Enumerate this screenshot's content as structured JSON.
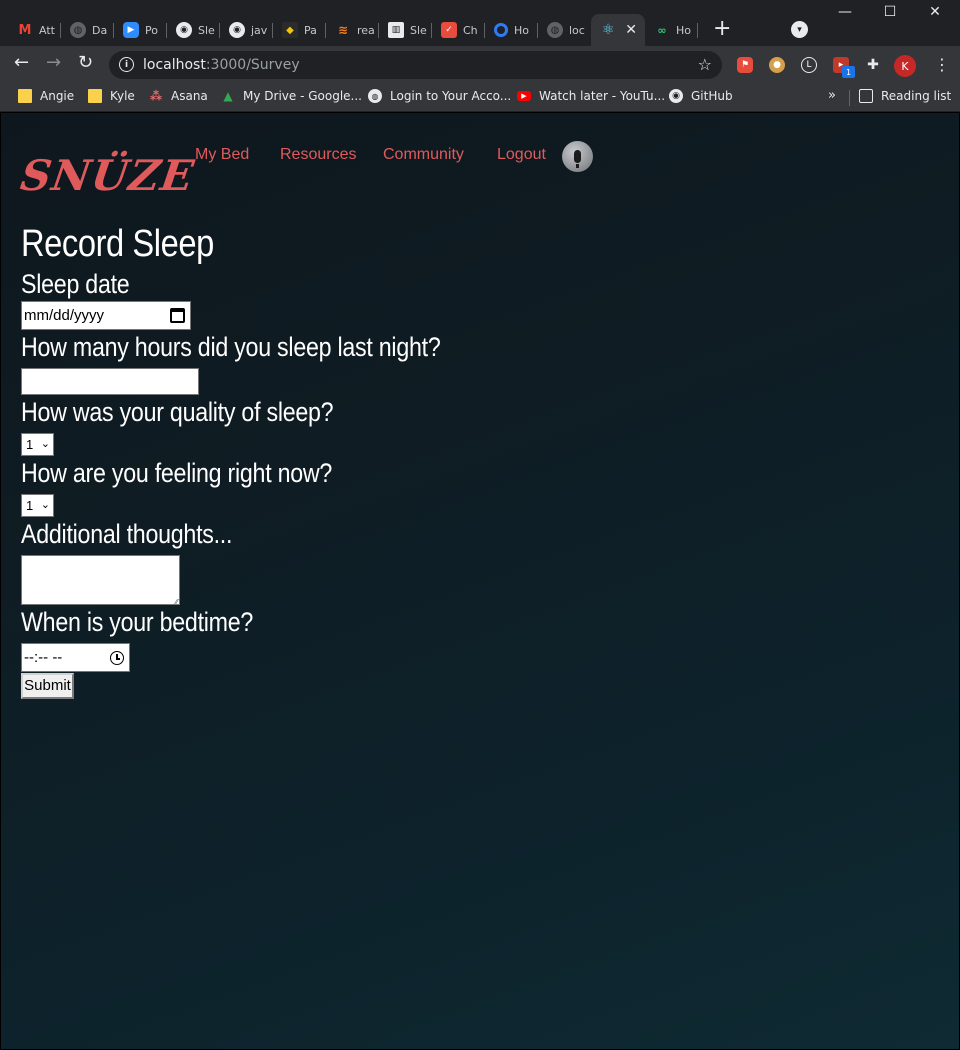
{
  "browser": {
    "tabs": [
      {
        "title": "Att",
        "icon": "gmail-icon"
      },
      {
        "title": "Da",
        "icon": "globe-icon"
      },
      {
        "title": "Po",
        "icon": "zoom-icon"
      },
      {
        "title": "Sle",
        "icon": "github-icon"
      },
      {
        "title": "jav",
        "icon": "github-icon"
      },
      {
        "title": "Pa",
        "icon": "dp-icon"
      },
      {
        "title": "rea",
        "icon": "stackoverflow-icon"
      },
      {
        "title": "Sle",
        "icon": "book-icon"
      },
      {
        "title": "Ch",
        "icon": "checklist-icon"
      },
      {
        "title": "Ho",
        "icon": "ring-icon"
      },
      {
        "title": "loc",
        "icon": "globe-icon"
      },
      {
        "title": "",
        "icon": "react-icon",
        "active": true
      },
      {
        "title": "Ho",
        "icon": "link-icon"
      }
    ],
    "url_host": "localhost",
    "url_path": ":3000/Survey",
    "profile_initial": "K",
    "extension_badge": "1",
    "bookmarks": [
      {
        "label": "Angie",
        "icon": "folder-icon"
      },
      {
        "label": "Kyle",
        "icon": "folder-icon"
      },
      {
        "label": "Asana",
        "icon": "asana-icon"
      },
      {
        "label": "My Drive - Google...",
        "icon": "drive-icon"
      },
      {
        "label": "Login to Your Acco...",
        "icon": "globe-icon"
      },
      {
        "label": "Watch later - YouTu...",
        "icon": "youtube-icon"
      },
      {
        "label": "GitHub",
        "icon": "github-icon"
      }
    ],
    "reading_list": "Reading list"
  },
  "site": {
    "logo": "SNÜZE",
    "nav": {
      "my_bed": "My Bed",
      "resources": "Resources",
      "community": "Community",
      "logout": "Logout"
    },
    "accent_color": "#e05a5c"
  },
  "survey": {
    "title": "Record Sleep",
    "sleep_date_label": "Sleep date",
    "sleep_date_placeholder": "mm/dd/yyyy",
    "hours_label": "How many hours did you sleep last night?",
    "hours_value": "",
    "quality_label": "How was your quality of sleep?",
    "quality_value": "1",
    "feeling_label": "How are you feeling right now?",
    "feeling_value": "1",
    "thoughts_label": "Additional thoughts...",
    "thoughts_value": "",
    "bedtime_label": "When is your bedtime?",
    "bedtime_placeholder": "--:-- --",
    "submit_label": "Submit"
  }
}
